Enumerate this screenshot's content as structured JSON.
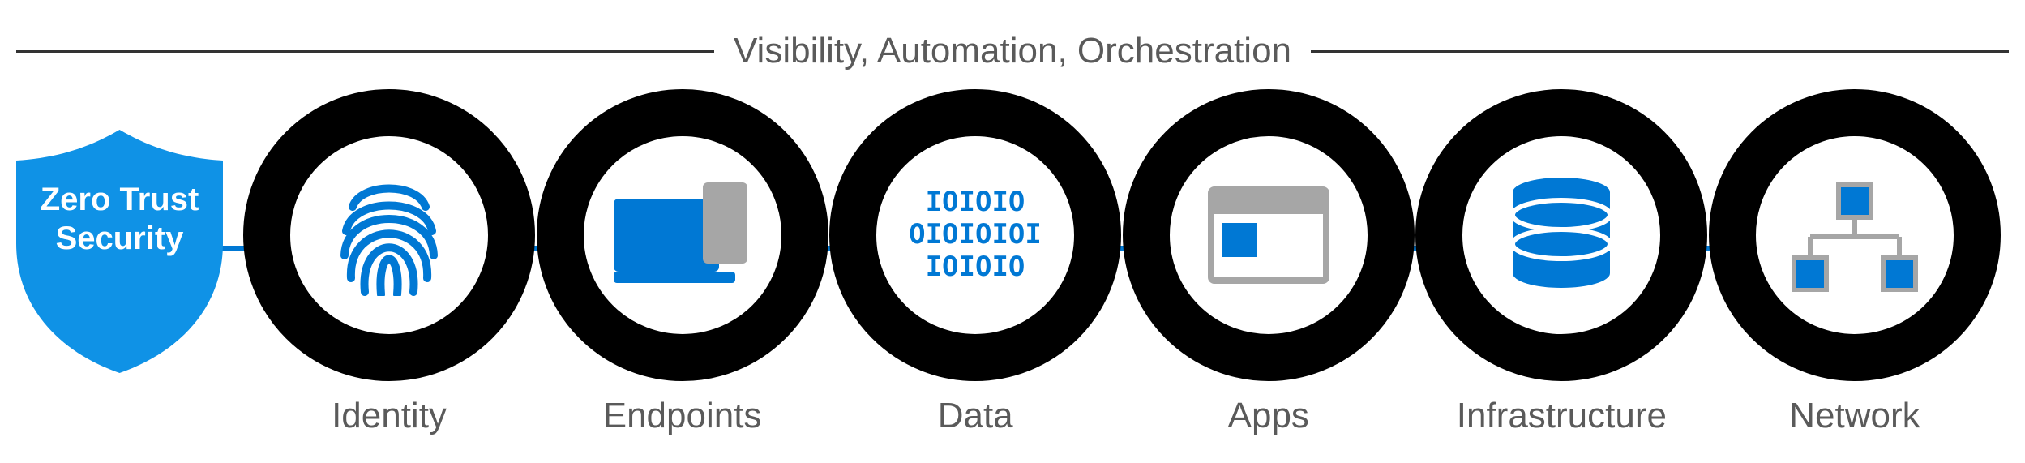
{
  "header": {
    "title": "Visibility, Automation, Orchestration"
  },
  "shield": {
    "line1": "Zero Trust",
    "line2": "Security"
  },
  "pillars": [
    {
      "icon": "fingerprint-icon",
      "label": "Identity"
    },
    {
      "icon": "devices-icon",
      "label": "Endpoints"
    },
    {
      "icon": "binary-data-icon",
      "label": "Data"
    },
    {
      "icon": "app-window-icon",
      "label": "Apps"
    },
    {
      "icon": "database-icon",
      "label": "Infrastructure"
    },
    {
      "icon": "network-tree-icon",
      "label": "Network"
    }
  ],
  "colors": {
    "accent": "#0078d4",
    "ring": "#000000",
    "text": "#5a5a5a",
    "iconGrey": "#a6a6a6"
  }
}
